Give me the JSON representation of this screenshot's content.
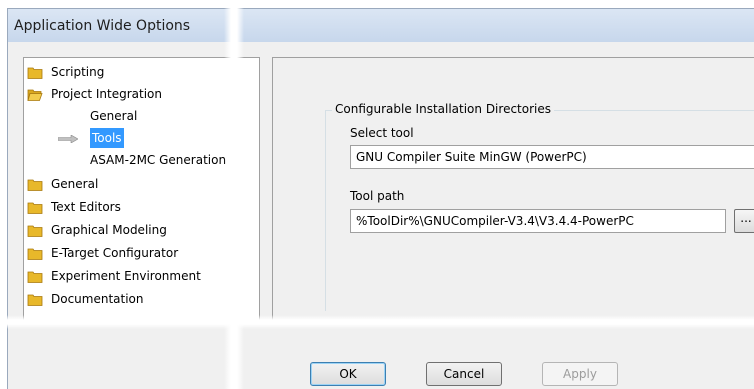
{
  "window": {
    "title": "Application Wide Options"
  },
  "tree": {
    "items": [
      {
        "label": "Scripting",
        "icon": "folder-icon"
      },
      {
        "label": "Project Integration",
        "icon": "folder-open-icon"
      },
      {
        "label": "General",
        "icon": ""
      },
      {
        "label": "Tools",
        "icon": "arrow-right-icon",
        "selected": true
      },
      {
        "label": "ASAM-2MC Generation",
        "icon": ""
      },
      {
        "label": "General",
        "icon": "folder-icon"
      },
      {
        "label": "Text Editors",
        "icon": "folder-icon"
      },
      {
        "label": "Graphical Modeling",
        "icon": "folder-icon"
      },
      {
        "label": "E-Target Configurator",
        "icon": "folder-icon"
      },
      {
        "label": "Experiment Environment",
        "icon": "folder-icon"
      },
      {
        "label": "Documentation",
        "icon": "folder-icon"
      }
    ]
  },
  "page": {
    "group_title": "Configurable Installation Directories",
    "select_tool_label": "Select tool",
    "select_tool_value": "GNU Compiler Suite MinGW (PowerPC)",
    "tool_path_label": "Tool path",
    "tool_path_value": "%ToolDir%\\GNUCompiler-V3.4\\V3.4.4-PowerPC",
    "browse_label": "..."
  },
  "buttons": {
    "ok": "OK",
    "cancel": "Cancel",
    "apply": "Apply"
  },
  "colors": {
    "selection": "#3399ff",
    "folder": "#e8b82a",
    "titlebar": "#c7d7ec"
  }
}
